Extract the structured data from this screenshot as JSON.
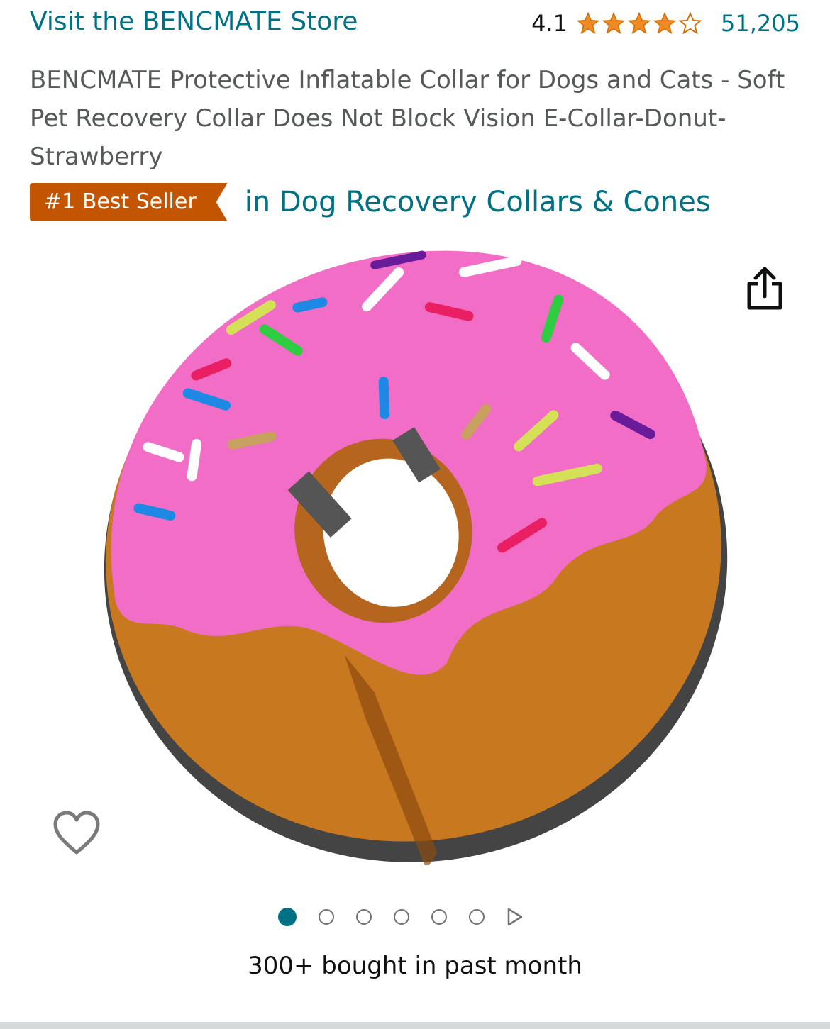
{
  "store": {
    "link_text": "Visit the BENCMATE Store"
  },
  "rating": {
    "value": "4.1",
    "stars": 4.1,
    "count": "51,205"
  },
  "product": {
    "title": "BENCMATE Protective Inflatable Collar for Dogs and Cats - Soft Pet Recovery Collar Does Not Block Vision E-Collar-Donut-Strawberry"
  },
  "badge": {
    "label": "#1 Best Seller",
    "category": "in Dog Recovery Collars & Cones"
  },
  "gallery": {
    "total_images": 6,
    "active_index": 0
  },
  "social_proof": {
    "text": "300+ bought in past month"
  },
  "colors": {
    "link": "#007185",
    "badge": "#c45500",
    "star": "#f08a24",
    "frosting": "#f26ec6",
    "dough": "#c8781f"
  },
  "icons": {
    "share": "share-icon",
    "wishlist": "heart-icon",
    "video": "play-icon"
  }
}
